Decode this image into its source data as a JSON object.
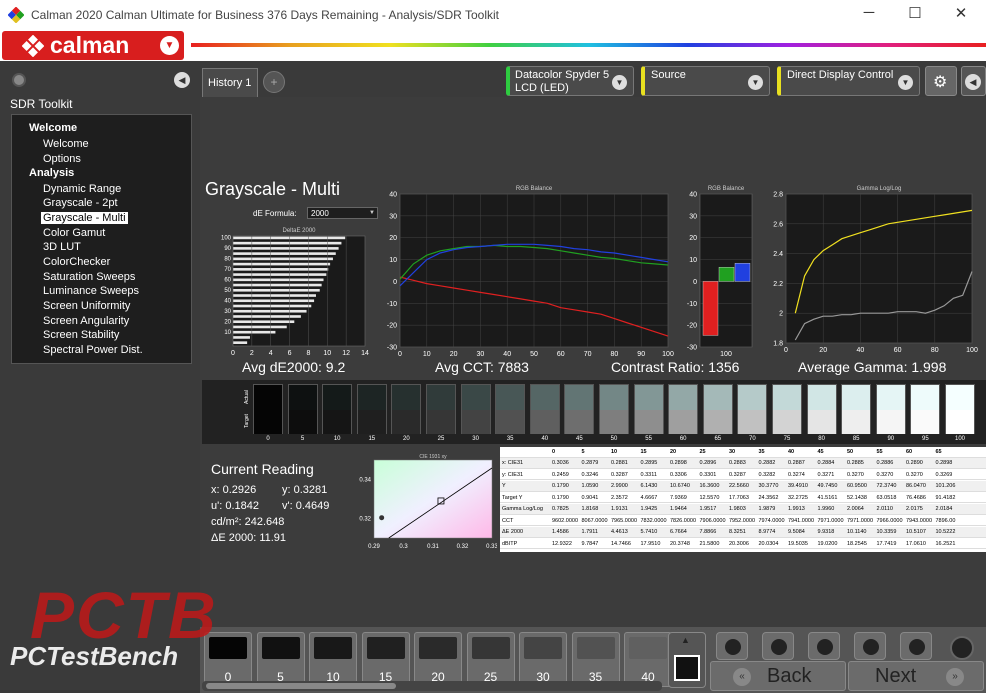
{
  "window": {
    "title": "Calman 2020 Calman Ultimate for Business 376 Days Remaining - Analysis/SDR Toolkit",
    "minimize": "─",
    "maximize": "☐",
    "close": "✕"
  },
  "brand": {
    "logo_text": "calman"
  },
  "sidebar": {
    "title": "SDR Toolkit",
    "sections": [
      {
        "label": "Welcome",
        "items": [
          "Welcome",
          "Options"
        ]
      },
      {
        "label": "Analysis",
        "items": [
          "Dynamic Range",
          "Grayscale - 2pt",
          "Grayscale - Multi",
          "Color Gamut",
          "3D LUT",
          "ColorChecker",
          "Saturation Sweeps",
          "Luminance Sweeps",
          "Screen Uniformity",
          "Screen Angularity",
          "Screen Stability",
          "Spectral Power Dist."
        ]
      }
    ],
    "selected": "Grayscale - Multi"
  },
  "tabs": {
    "history": "History 1",
    "add": "+"
  },
  "devices": {
    "meter": "Datacolor Spyder 5\nLCD (LED)",
    "source": "Source",
    "display": "Direct Display Control"
  },
  "page": {
    "title": "Grayscale - Multi",
    "de_formula_label": "dE Formula:",
    "de_formula_value": "2000"
  },
  "stats": {
    "avg_de": "Avg dE2000: 9.2",
    "avg_cct": "Avg CCT: 7883",
    "contrast": "Contrast Ratio: 1356",
    "avg_gamma": "Average Gamma: 1.998"
  },
  "chart_data": [
    {
      "type": "bar",
      "title": "DeltaE 2000",
      "orientation": "horizontal",
      "categories": [
        "100",
        "95",
        "90",
        "85",
        "80",
        "75",
        "70",
        "65",
        "60",
        "55",
        "50",
        "45",
        "40",
        "35",
        "30",
        "25",
        "20",
        "15",
        "10",
        "5",
        "0"
      ],
      "values": [
        11.9,
        11.5,
        11.2,
        10.9,
        10.6,
        10.3,
        10.1,
        9.9,
        9.6,
        9.4,
        9.2,
        8.8,
        8.6,
        8.3,
        7.8,
        7.2,
        6.5,
        5.7,
        4.5,
        1.8,
        1.5
      ],
      "xlim": [
        0,
        14
      ],
      "xticks": [
        "0",
        "2",
        "4",
        "6",
        "8",
        "10",
        "12",
        "14"
      ],
      "yticks": [
        "100",
        "95",
        "90",
        "85",
        "80",
        "75",
        "70",
        "65",
        "60",
        "55",
        "50",
        "45",
        "40",
        "35",
        "30",
        "25",
        "20",
        "15",
        "10",
        "5",
        "0"
      ]
    },
    {
      "type": "line",
      "title": "RGB Balance",
      "x": [
        0,
        5,
        10,
        15,
        20,
        25,
        30,
        35,
        40,
        45,
        50,
        55,
        60,
        65,
        70,
        75,
        80,
        85,
        90,
        95,
        100
      ],
      "ylim": [
        -30,
        40
      ],
      "xlim": [
        0,
        100
      ],
      "xticks": [
        "0",
        "10",
        "20",
        "30",
        "40",
        "50",
        "60",
        "70",
        "80",
        "90",
        "100"
      ],
      "yticks": [
        "40",
        "30",
        "20",
        "10",
        "0",
        "-10",
        "-20",
        "-30"
      ],
      "series": [
        {
          "color": "#e02020",
          "values": [
            2,
            0.5,
            -1,
            -2,
            -3,
            -4,
            -5,
            -6,
            -7,
            -8,
            -9,
            -10,
            -12,
            -13,
            -14,
            -15,
            -17,
            -19,
            -21,
            -23,
            -25
          ]
        },
        {
          "color": "#20a020",
          "values": [
            1,
            8,
            12,
            14,
            15,
            16,
            16,
            16.5,
            16,
            16,
            15.5,
            15,
            14,
            13,
            12,
            11,
            10.5,
            9.5,
            8.5,
            8,
            7.5
          ]
        },
        {
          "color": "#2040e0",
          "values": [
            -2,
            4,
            10,
            13,
            14.5,
            15.5,
            16,
            16.5,
            17,
            17,
            17,
            16.5,
            16,
            15,
            14.5,
            13.5,
            13,
            12,
            11,
            10,
            9
          ]
        }
      ]
    },
    {
      "type": "bar",
      "title": "RGB Balance",
      "categories": [
        "R",
        "G",
        "B"
      ],
      "values": [
        -24.7,
        6.5,
        8.3
      ],
      "colors": [
        "#e02020",
        "#20a020",
        "#2040e0"
      ],
      "ylim": [
        -30,
        40
      ],
      "yticks": [
        "40",
        "30",
        "20",
        "10",
        "0",
        "-10",
        "-20",
        "-30"
      ],
      "xticks": [
        "100"
      ]
    },
    {
      "type": "line",
      "title": "Gamma Log/Log",
      "x": [
        5,
        10,
        15,
        20,
        25,
        30,
        35,
        40,
        45,
        50,
        55,
        60,
        65,
        70,
        75,
        80,
        85,
        90,
        95,
        100
      ],
      "ylim": [
        1.8,
        2.8
      ],
      "xlim": [
        0,
        100
      ],
      "xticks": [
        "0",
        "20",
        "40",
        "60",
        "80",
        "100"
      ],
      "yticks": [
        "2.8",
        "2.6",
        "2.4",
        "2.2",
        "2",
        "1.8"
      ],
      "series": [
        {
          "name": "target",
          "color": "#f0e020",
          "values": [
            2.0,
            2.25,
            2.36,
            2.42,
            2.46,
            2.5,
            2.52,
            2.54,
            2.56,
            2.58,
            2.6,
            2.61,
            2.62,
            2.63,
            2.64,
            2.65,
            2.66,
            2.67,
            2.68,
            2.69
          ]
        },
        {
          "name": "measured",
          "color": "#999999",
          "values": [
            1.82,
            1.93,
            1.96,
            1.98,
            1.98,
            1.99,
            1.99,
            2.0,
            2.0,
            2.0,
            2.0,
            2.01,
            2.01,
            2.01,
            2.0,
            2.02,
            2.05,
            2.1,
            2.12,
            2.28
          ]
        }
      ]
    },
    {
      "type": "scatter",
      "title": "CIE 1931 xy",
      "xlim": [
        0.29,
        0.33
      ],
      "ylim": [
        0.31,
        0.35
      ],
      "xticks": [
        "0.29",
        "0.3",
        "0.31",
        "0.32",
        "0.33"
      ],
      "yticks": [
        "0.34",
        "0.32"
      ],
      "target": {
        "x": 0.3127,
        "y": 0.329
      },
      "measured": {
        "x": 0.2926,
        "y": 0.3281
      }
    }
  ],
  "swatches": {
    "side_labels": [
      "Actual",
      "Target"
    ],
    "labels": [
      "0",
      "5",
      "10",
      "15",
      "20",
      "25",
      "30",
      "35",
      "40",
      "45",
      "50",
      "55",
      "60",
      "65",
      "70",
      "75",
      "80",
      "85",
      "90",
      "95",
      "100"
    ],
    "actual": [
      "#050505",
      "#0e1111",
      "#141a19",
      "#1d2524",
      "#26302f",
      "#303b3a",
      "#3a4847",
      "#485756",
      "#556665",
      "#627574",
      "#738786",
      "#829796",
      "#93a8a7",
      "#a4b9b8",
      "#b5cac9",
      "#c3d9d8",
      "#d1e6e5",
      "#dceeee",
      "#e5f5f5",
      "#eefbfb",
      "#f5ffff"
    ],
    "target": [
      "#050505",
      "#0d0d0d",
      "#151515",
      "#1f1f1f",
      "#2a2a2a",
      "#363636",
      "#434343",
      "#515151",
      "#5f5f5f",
      "#6e6e6e",
      "#7e7e7e",
      "#8e8e8e",
      "#9f9f9f",
      "#b0b0b0",
      "#c1c1c1",
      "#d3d3d3",
      "#e5e5e5",
      "#eeeeee",
      "#f5f5f5",
      "#fafafa",
      "#ffffff"
    ]
  },
  "reading": {
    "title": "Current Reading",
    "x": "x: 0.2926",
    "y": "y: 0.3281",
    "u": "u': 0.1842",
    "v": "v': 0.4649",
    "cd": "cd/m²: 242.648",
    "de": "ΔE 2000: 11.91"
  },
  "table": {
    "headers": [
      "",
      "0",
      "5",
      "10",
      "15",
      "20",
      "25",
      "30",
      "35",
      "40",
      "45",
      "50",
      "55",
      "60",
      "65"
    ],
    "rows": [
      [
        "x: CIE31",
        "0.3036",
        "0.2879",
        "0.2881",
        "0.2895",
        "0.2898",
        "0.2896",
        "0.2883",
        "0.2882",
        "0.2887",
        "0.2884",
        "0.2885",
        "0.2886",
        "0.2890",
        "0.2898"
      ],
      [
        "y: CIE31",
        "0.2459",
        "0.3246",
        "0.3287",
        "0.3311",
        "0.3306",
        "0.3301",
        "0.3287",
        "0.3282",
        "0.3274",
        "0.3271",
        "0.3270",
        "0.3270",
        "0.3270",
        "0.3269"
      ],
      [
        "Y",
        "0.1790",
        "1.0590",
        "2.9900",
        "6.1430",
        "10.6740",
        "16.3600",
        "22.5660",
        "30.3770",
        "39.4910",
        "49.7450",
        "60.9500",
        "72.3740",
        "86.0470",
        "101.206"
      ],
      [
        "Target Y",
        "0.1790",
        "0.9041",
        "2.3572",
        "4.6667",
        "7.9369",
        "12.5570",
        "17.7063",
        "24.3562",
        "32.2725",
        "41.5161",
        "52.1438",
        "63.0518",
        "76.4686",
        "91.4182"
      ],
      [
        "Gamma Log/Log",
        "0.7825",
        "1.8168",
        "1.9131",
        "1.9425",
        "1.9464",
        "1.9517",
        "1.9803",
        "1.9879",
        "1.9913",
        "1.9960",
        "2.0064",
        "2.0110",
        "2.0175",
        "2.0184"
      ],
      [
        "CCT",
        "9602.0000",
        "8067.0000",
        "7965.0000",
        "7832.0000",
        "7826.0000",
        "7906.0000",
        "7952.0000",
        "7974.0000",
        "7941.0000",
        "7971.0000",
        "7971.0000",
        "7966.0000",
        "7943.0000",
        "7896.00"
      ],
      [
        "ΔE 2000",
        "1.4586",
        "1.7911",
        "4.4613",
        "5.7410",
        "6.7664",
        "7.8866",
        "8.3251",
        "8.9774",
        "9.5084",
        "9.9318",
        "10.1140",
        "10.3359",
        "10.5107",
        "10.5222"
      ],
      [
        "dBITP",
        "12.9322",
        "9.7847",
        "14.7466",
        "17.9510",
        "20.3748",
        "21.5800",
        "20.3006",
        "20.0304",
        "19.5035",
        "19.0200",
        "18.2545",
        "17.7419",
        "17.0610",
        "16.2521"
      ]
    ]
  },
  "thumbs": [
    "0",
    "5",
    "10",
    "15",
    "20",
    "25",
    "30",
    "35",
    "40"
  ],
  "nav": {
    "back": "Back",
    "next": "Next"
  },
  "watermark": {
    "big": "PCTB",
    "small": "PCTestBench"
  },
  "colors": {
    "accent": "#d81e1e",
    "meter_status": "#2ecc40",
    "status_yellow": "#e8e020"
  }
}
